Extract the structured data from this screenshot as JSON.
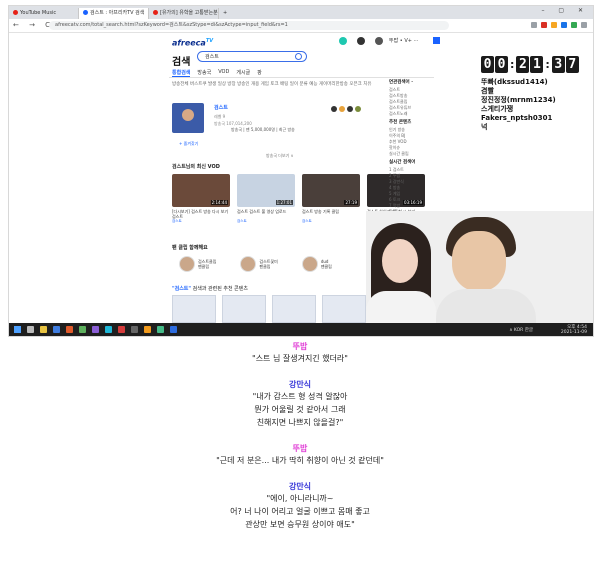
{
  "browser": {
    "tabs": [
      {
        "label": "YouTube Music",
        "color": "#e62117"
      },
      {
        "label": "검스트 : 아프리카TV 검색",
        "color": "#1a62ff"
      },
      {
        "label": "[유가의] 유학을 고통받는분",
        "color": "#e62117"
      }
    ],
    "new_tab": "+",
    "window_controls": "– ▢ ✕",
    "nav_buttons": "← → C",
    "url": "afreecatv.com/total_search.html?szKeyword=검스트&szStype=di&szActype=input_field&rs=1"
  },
  "afreeca": {
    "logo": "afreeca",
    "logo_suffix": "TV",
    "user": "뚜밥 • V+ ···",
    "search_title": "검색",
    "search_value": "검스트",
    "tabs": [
      "통합검색",
      "방송국",
      "VOD",
      "게시글",
      "팡"
    ],
    "filters": "방송전체   버스트쿠   발생   일상   방장   방송인   개용   게임   토크   배팅   일이   분류   예능   게이머리한방송   오픈크   치유",
    "profile": {
      "name": "검스트",
      "meta_line1": "레벨  9",
      "meta_line2": "방송국  107,014,200",
      "meta_line3": "지금 방송 제목이 들어가는 영역입니다",
      "desc": "방송국 | 팬 5,000,000명 | 최근 방송",
      "follow": "+ 즐겨찾기"
    },
    "more": "방송국 더보기 ∨",
    "vod_header": "검스트님의 최신 VOD",
    "vods": [
      {
        "title": "[다시보기] 검스트 방송 다시 보기 검스트",
        "meta": "검스트",
        "duration": "2:14:44"
      },
      {
        "title": "검스트 검스트 풀 영상 업로드",
        "meta": "검스트",
        "duration": "1:27:01"
      },
      {
        "title": "검스트 방송 기록 클립",
        "meta": "검스트",
        "duration": "27:19"
      },
      {
        "title": "검스트 하이라이트 다시 보기",
        "meta": "검스트",
        "duration": "03:16:19"
      }
    ],
    "clips_header": "팬 클립 함께해요",
    "clips": [
      {
        "name": "검스트클립",
        "sub": "팬클립"
      },
      {
        "name": "검스트꽃미",
        "sub": "팬클립"
      },
      {
        "name": "dud",
        "sub": "팬클립"
      }
    ],
    "riv_header_b": "\"검스트\"",
    "riv_header": " 검색과 관련된 추천 콘텐츠",
    "side": {
      "h1": "연관검색어 ·",
      "items1": [
        "검스트",
        "검스트방송",
        "검스트클립",
        "검스트유튜브",
        "검스트노래"
      ],
      "h2": "추천 콘텐츠",
      "items2": [
        "인기 방송",
        "이주의 BJ",
        "추천 VOD",
        "핫이슈",
        "실시간 클립"
      ],
      "h3": "실시간 검색어",
      "items3": [
        "1  검스트",
        "2  뚜밥",
        "3  강만식",
        "4  방송",
        "5  게임",
        "6  토크",
        "7  먹방",
        "8  음악"
      ]
    }
  },
  "overlay": {
    "timer": [
      "0",
      "0",
      "2",
      "1",
      "3",
      "7"
    ],
    "chat": [
      {
        "user": "뚜빠(dkssud1414)",
        "msg": ""
      },
      {
        "user": "",
        "msg": "겸빨"
      },
      {
        "user": "정진정정(mrnm1234)",
        "msg": ""
      },
      {
        "user": "",
        "msg": "스게티가쟁"
      },
      {
        "user": "Fakers_nptsh0301",
        "msg": ""
      },
      {
        "user": "",
        "msg": "넉"
      }
    ]
  },
  "taskbar": {
    "tray": "∧  KOR  한글",
    "time": "오후 4:54",
    "date": "2021-11-09"
  },
  "script": [
    {
      "speaker": "뚜밥",
      "color": "pink",
      "lines": [
        "\"스트 님 잘생겨지긴 했더라\""
      ]
    },
    {
      "speaker": "강만식",
      "color": "blue",
      "lines": [
        "\"내가 감스트 형 성격 알잖아",
        "뭔가 어울릴 것 같아서 그래",
        "친해지면 나쁘지 않을걸?\""
      ]
    },
    {
      "speaker": "뚜밥",
      "color": "pink",
      "lines": [
        "\"근데 저 분은... 내가 딱히 취향이 아닌 것 같던데\""
      ]
    },
    {
      "speaker": "강만식",
      "color": "blue",
      "lines": [
        "\"에이, 아니라니까~",
        "어? 너 나이 어리고 얼굴 이쁘고 몸매 좋고",
        "관상만 보면 승무원 상이야 애도\""
      ]
    }
  ]
}
